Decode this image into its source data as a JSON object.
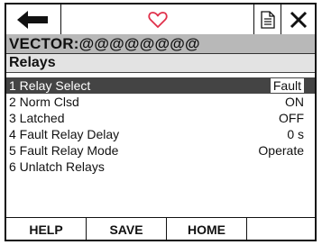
{
  "toolbar": {
    "back_icon": "left-arrow-icon",
    "heart_icon": "heart-outline-icon",
    "heart_color": "#e0304a",
    "doc_icon": "document-icon",
    "close_icon": "close-x-icon"
  },
  "device": {
    "name": "VECTOR:@@@@@@@@"
  },
  "menu": {
    "title": "Relays"
  },
  "items": [
    {
      "label": "1 Relay Select",
      "value": "Fault",
      "selected": true
    },
    {
      "label": "2 Norm Clsd",
      "value": "ON"
    },
    {
      "label": "3 Latched",
      "value": "OFF"
    },
    {
      "label": "4 Fault Relay Delay",
      "value": "0 s"
    },
    {
      "label": "5 Fault Relay Mode",
      "value": "Operate"
    },
    {
      "label": "6 Unlatch Relays",
      "value": ""
    }
  ],
  "softkeys": {
    "help": "HELP",
    "save": "SAVE",
    "home": "HOME",
    "blank": ""
  }
}
